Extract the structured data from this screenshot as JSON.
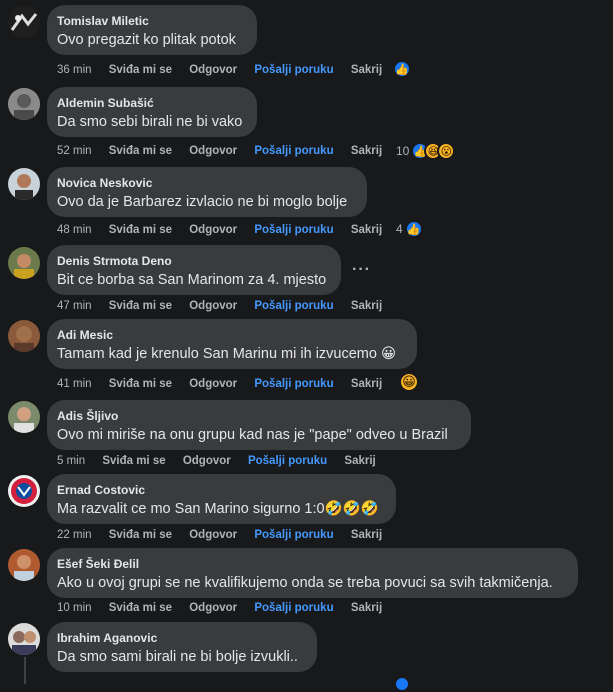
{
  "actions": {
    "like": "Sviđa mi se",
    "reply": "Odgovor",
    "message": "Pošalji poruku",
    "hide": "Sakrij"
  },
  "comments": [
    {
      "author": "Tomislav Miletic",
      "text": "Ovo pregazit ko plitak potok",
      "time": "36 min",
      "react_count": "",
      "reactions": [
        "like"
      ]
    },
    {
      "author": "Aldemin Subašić",
      "text": "Da smo sebi birali ne bi vako",
      "time": "52 min",
      "react_count": "10",
      "reactions": [
        "like",
        "haha",
        "wow"
      ]
    },
    {
      "author": "Novica Neskovic",
      "text": "Ovo da je Barbarez izvlacio ne bi moglo bolje",
      "time": "48 min",
      "react_count": "4",
      "reactions": [
        "like"
      ]
    },
    {
      "author": "Denis Strmota Deno",
      "text": "Bit ce borba sa San Marinom za 4. mjesto",
      "time": "47 min",
      "react_count": "",
      "reactions": []
    },
    {
      "author": "Adi Mesic",
      "text": "Tamam kad je krenulo San Marinu mi ih izvucemo 😀",
      "time": "41 min",
      "react_count": "",
      "reactions": [
        "grin"
      ]
    },
    {
      "author": "Adis Šljivo",
      "text": "Ovo mi miriše na onu grupu kad nas je \"pape\" odveo u Brazil",
      "time": "5 min",
      "react_count": "",
      "reactions": []
    },
    {
      "author": "Ernad Costovic",
      "text": "Ma razvalit ce mo San Marino sigurno 1:0🤣🤣🤣",
      "time": "22 min",
      "react_count": "",
      "reactions": []
    },
    {
      "author": "Ešef Šeki Đelil",
      "text": "Ako u ovoj grupi se ne kvalifikujemo onda se treba povuci sa svih takmičenja.",
      "time": "10 min",
      "react_count": "",
      "reactions": []
    },
    {
      "author": "Ibrahim Aganovic",
      "text": "Da smo sami birali ne bi bolje izvukli..",
      "time": "",
      "react_count": "",
      "reactions": []
    }
  ],
  "more_options": "···",
  "colors": {
    "background": "#18191a",
    "bubble": "#3a3b3c",
    "link_blue": "#4599ff",
    "like_blue": "#1877f2"
  }
}
